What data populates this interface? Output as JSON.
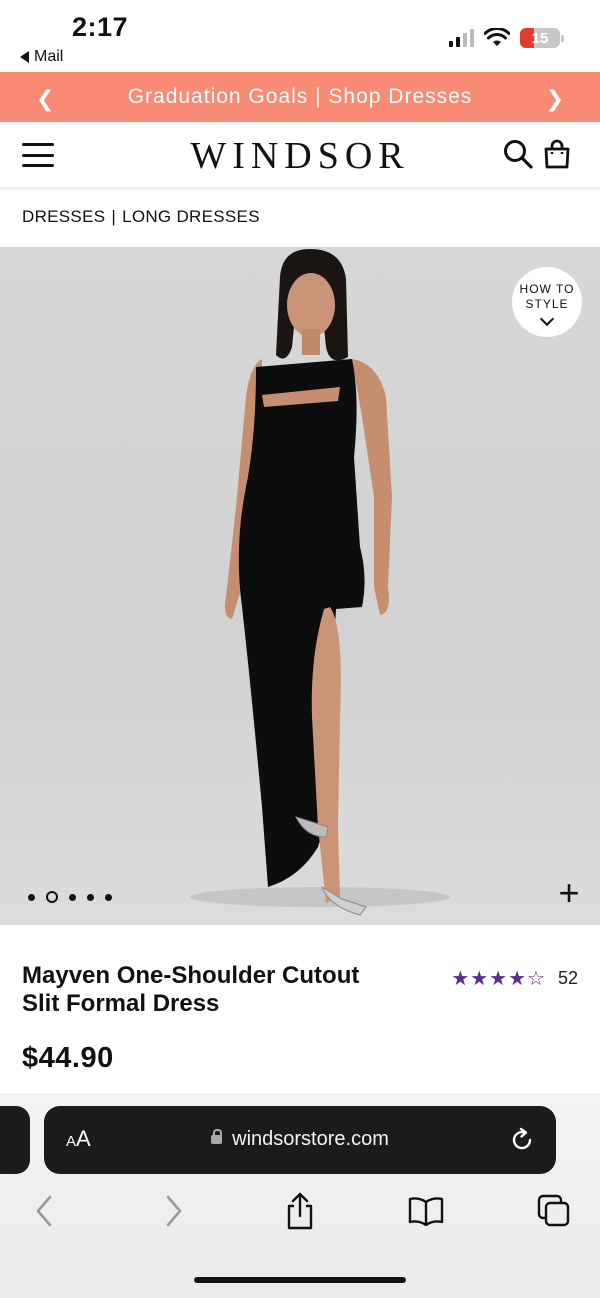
{
  "status_bar": {
    "time": "2:17",
    "back_app": "Mail",
    "battery": "15"
  },
  "promo": {
    "text": "Graduation Goals | Shop Dresses"
  },
  "header": {
    "logo": "WINDSOR"
  },
  "breadcrumb": {
    "items": [
      "DRESSES",
      "LONG DRESSES"
    ],
    "separator": "|"
  },
  "product": {
    "how_to_style_line1": "HOW TO",
    "how_to_style_line2": "STYLE",
    "image_dots": {
      "count": 5,
      "active_index": 1
    },
    "title_line1": "Mayven One-Shoulder Cutout",
    "title_line2": "Slit Formal Dress",
    "rating_stars": "★★★★☆",
    "rating_value": 4.5,
    "rating_count": "52",
    "price": "$44.90"
  },
  "safari": {
    "aa_label": "AA",
    "url": "windsorstore.com"
  },
  "colors": {
    "promo_bg": "#f98a73",
    "star": "#5b2d8e",
    "address_bar": "#1b1b1b"
  }
}
